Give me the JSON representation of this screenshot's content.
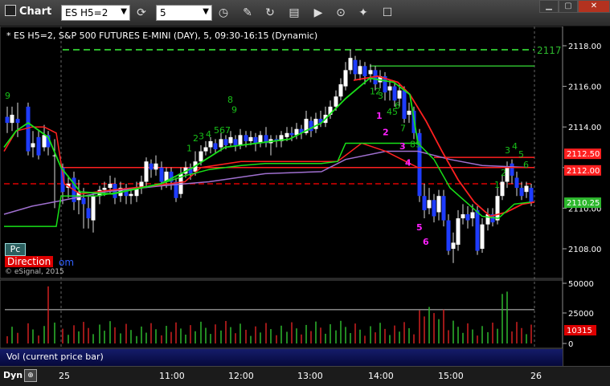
{
  "window": {
    "title": "Chart"
  },
  "toolbar": {
    "symbol_value": "ES H5=2",
    "interval_value": "5",
    "icons": [
      "refresh-icon",
      "clock-icon",
      "pencil-icon",
      "cycle-icon",
      "study-icon",
      "play-icon",
      "cursor-icon",
      "comment-icon"
    ]
  },
  "legend": "* ES H5=2, S&P 500 FUTURES E-MINI (DAY), 5, 09:30-16:15 (Dynamic)",
  "price_axis": {
    "ticks": [
      "2118.00",
      "2116.00",
      "2114.00",
      "2112.00",
      "2110.00",
      "2108.00"
    ],
    "badges": [
      {
        "label": "2112.50",
        "color": "#ff2020"
      },
      {
        "label": "2112.00",
        "color": "#ff2020"
      },
      {
        "label": "2110.25",
        "color": "#2db82d"
      }
    ],
    "dashed_label": "2117"
  },
  "pc_label": "Pc",
  "direction_label": "Direction",
  "direction_tail": "om",
  "copyright": "© eSignal, 2015",
  "volume": {
    "label": "Vol (current price bar)",
    "ticks": [
      "50000",
      "25000",
      "0"
    ],
    "current": "10315"
  },
  "time_axis": {
    "dyn": "Dyn",
    "zoom_icon": "zoom-icon",
    "labels": [
      "25",
      "11:00",
      "12:00",
      "13:00",
      "14:00",
      "15:00",
      "26"
    ]
  },
  "markers": {
    "green": [
      {
        "t": "9"
      },
      {
        "t": "1"
      },
      {
        "t": "2"
      },
      {
        "t": "3"
      },
      {
        "t": "4"
      },
      {
        "t": "567"
      },
      {
        "t": "8"
      },
      {
        "t": "9"
      },
      {
        "t": "12"
      },
      {
        "t": "3"
      },
      {
        "t": "45"
      },
      {
        "t": "6"
      },
      {
        "t": "7"
      },
      {
        "t": "89"
      },
      {
        "t": "3"
      },
      {
        "t": "4"
      },
      {
        "t": "5"
      },
      {
        "t": "2"
      },
      {
        "t": "6"
      },
      {
        "t": "1"
      }
    ],
    "magenta": [
      {
        "t": "1"
      },
      {
        "t": "2"
      },
      {
        "t": "3"
      },
      {
        "t": "4"
      },
      {
        "t": "5"
      },
      {
        "t": "6"
      }
    ]
  },
  "colors": {
    "bull_candle": "#ffffff",
    "bear_candle": "#1e3cff",
    "ma_red": "#ff2020",
    "ma_green": "#18e018",
    "ma_purple": "#a070d0",
    "hline_green_dashed": "#2db82d"
  }
}
